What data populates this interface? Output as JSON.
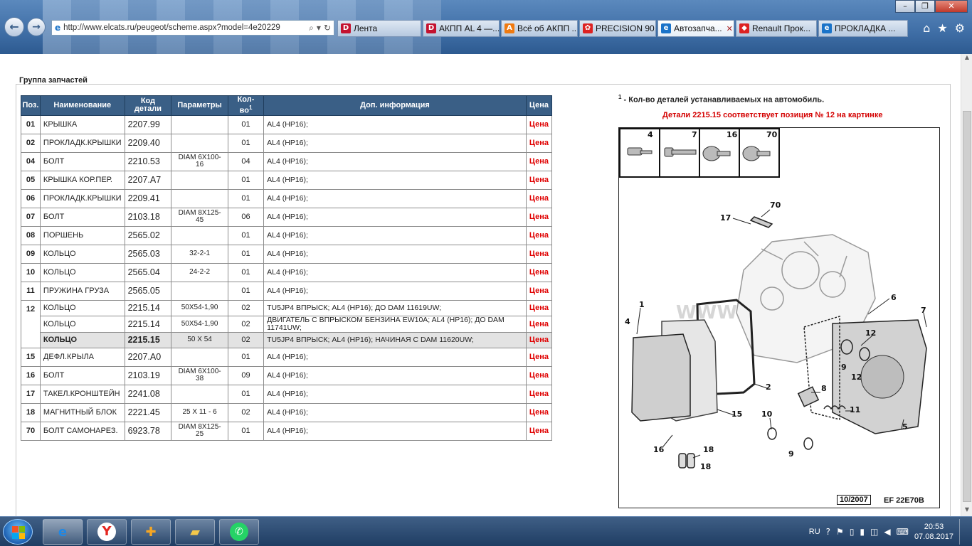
{
  "browser": {
    "url": "http://www.elcats.ru/peugeot/scheme.aspx?model=4e20229",
    "tabs": [
      {
        "label": "Лента",
        "fav": "D",
        "favcolor": "#c4122f"
      },
      {
        "label": "АКПП AL 4 —...",
        "fav": "D",
        "favcolor": "#c4122f"
      },
      {
        "label": "Всё об АКПП ...",
        "fav": "A",
        "favcolor": "#f07a10"
      },
      {
        "label": "PRECISION 90...",
        "fav": "✿",
        "favcolor": "#d22"
      },
      {
        "label": "Автозапча...",
        "fav": "e",
        "favcolor": "#1a73c9",
        "active": true
      },
      {
        "label": "Renault Прок...",
        "fav": "◆",
        "favcolor": "#d22"
      },
      {
        "label": "ПРОКЛАДКА ...",
        "fav": "e",
        "favcolor": "#1a73c9"
      }
    ]
  },
  "page": {
    "group_title": "Группа запчастей",
    "columns": {
      "pos": "Поз.",
      "name": "Наименование",
      "code_1": "Код",
      "code_2": "детали",
      "params": "Параметры",
      "qty_1": "Кол-",
      "qty_2": "во",
      "qty_sup": "1",
      "info": "Доп. информация",
      "price": "Цена"
    },
    "rows": [
      {
        "pos": "01",
        "name": "КРЫШКА",
        "code": "2207.99",
        "params": "",
        "qty": "01",
        "info": "AL4 (HP16);",
        "price": "Цена"
      },
      {
        "pos": "02",
        "name": "ПРОКЛАДК.КРЫШКИ",
        "code": "2209.40",
        "params": "",
        "qty": "01",
        "info": "AL4 (HP16);",
        "price": "Цена"
      },
      {
        "pos": "04",
        "name": "БОЛТ",
        "code": "2210.53",
        "params": "DIAM 6X100-16",
        "qty": "04",
        "info": "AL4 (HP16);",
        "price": "Цена"
      },
      {
        "pos": "05",
        "name": "КРЫШКА КОР.ПЕР.",
        "code": "2207.A7",
        "params": "",
        "qty": "01",
        "info": "AL4 (HP16);",
        "price": "Цена"
      },
      {
        "pos": "06",
        "name": "ПРОКЛАДК.КРЫШКИ",
        "code": "2209.41",
        "params": "",
        "qty": "01",
        "info": "AL4 (HP16);",
        "price": "Цена"
      },
      {
        "pos": "07",
        "name": "БОЛТ",
        "code": "2103.18",
        "params": "DIAM 8X125-45",
        "qty": "06",
        "info": "AL4 (HP16);",
        "price": "Цена"
      },
      {
        "pos": "08",
        "name": "ПОРШЕНЬ",
        "code": "2565.02",
        "params": "",
        "qty": "01",
        "info": "AL4 (HP16);",
        "price": "Цена"
      },
      {
        "pos": "09",
        "name": "КОЛЬЦО",
        "code": "2565.03",
        "params": "32-2-1",
        "qty": "01",
        "info": "AL4 (HP16);",
        "price": "Цена"
      },
      {
        "pos": "10",
        "name": "КОЛЬЦО",
        "code": "2565.04",
        "params": "24-2-2",
        "qty": "01",
        "info": "AL4 (HP16);",
        "price": "Цена"
      },
      {
        "pos": "11",
        "name": "ПРУЖИНА ГРУЗА",
        "code": "2565.05",
        "params": "",
        "qty": "01",
        "info": "AL4 (HP16);",
        "price": "Цена"
      }
    ],
    "group12": {
      "pos": "12",
      "subrows": [
        {
          "name": "КОЛЬЦО",
          "code": "2215.14",
          "params": "50X54-1,90",
          "qty": "02",
          "info": "TU5JP4 ВПРЫСК; AL4 (HP16); ДО DAM 11619UW;",
          "price": "Цена"
        },
        {
          "name": "КОЛЬЦО",
          "code": "2215.14",
          "params": "50X54-1,90",
          "qty": "02",
          "info": "ДВИГАТЕЛЬ С ВПРЫСКОМ БЕНЗИНА EW10A; AL4 (HP16); ДО DAM 11741UW;",
          "price": "Цена"
        },
        {
          "name": "КОЛЬЦО",
          "code": "2215.15",
          "params": "50 X 54",
          "qty": "02",
          "info": "TU5JP4 ВПРЫСК; AL4 (HP16); НАЧИНАЯ С DAM 11620UW;",
          "price": "Цена"
        }
      ]
    },
    "rows_after": [
      {
        "pos": "15",
        "name": "ДЕФЛ.КРЫЛА",
        "code": "2207.A0",
        "params": "",
        "qty": "01",
        "info": "AL4 (HP16);",
        "price": "Цена"
      },
      {
        "pos": "16",
        "name": "БОЛТ",
        "code": "2103.19",
        "params": "DIAM 6X100-38",
        "qty": "09",
        "info": "AL4 (HP16);",
        "price": "Цена"
      },
      {
        "pos": "17",
        "name": "ТАКЕЛ.КРОНШТЕЙН",
        "code": "2241.08",
        "params": "",
        "qty": "01",
        "info": "AL4 (HP16);",
        "price": "Цена"
      },
      {
        "pos": "18",
        "name": "МАГНИТНЫЙ БЛОК",
        "code": "2221.45",
        "params": "25 X 11 - 6",
        "qty": "02",
        "info": "AL4 (HP16);",
        "price": "Цена"
      },
      {
        "pos": "70",
        "name": "БОЛТ САМОНАРЕЗ.",
        "code": "6923.78",
        "params": "DIAM 8X125-25",
        "qty": "01",
        "info": "AL4 (HP16);",
        "price": "Цена"
      }
    ],
    "note_sup": "1",
    "note": " - Кол-во деталей устанавливаемых на автомобиль.",
    "note_red": "Детали 2215.15 соответствует позиция № 12 на картинке",
    "diagram": {
      "bolt_labels": [
        "4",
        "7",
        "16",
        "70"
      ],
      "watermark": "WWW.ELCATS.RU",
      "part_labels": [
        "70",
        "17",
        "1",
        "4",
        "6",
        "7",
        "12",
        "9",
        "12",
        "2",
        "15",
        "8",
        "11",
        "10",
        "5",
        "9",
        "16",
        "18",
        "18"
      ],
      "footer_date": "10/2007",
      "footer_code": "EF 22E70B"
    }
  },
  "taskbar": {
    "lang": "RU",
    "time": "20:53",
    "date": "07.08.2017"
  }
}
